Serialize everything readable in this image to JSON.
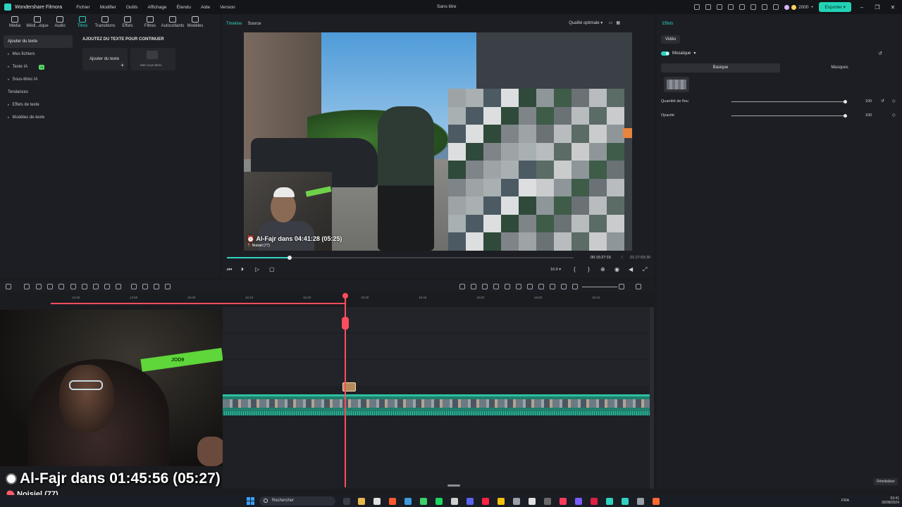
{
  "titlebar": {
    "app_name": "Wondershare Filmora",
    "menu": [
      "Fichier",
      "Modifier",
      "Outils",
      "Affichage",
      "Étendu",
      "Aide",
      "Version"
    ],
    "document_title": "Sans titre",
    "credits": "2000",
    "export_label": "Exporter"
  },
  "toolbar": {
    "items": [
      {
        "label": "Média",
        "icon": "media-icon"
      },
      {
        "label": "Médi...èque",
        "icon": "library-icon"
      },
      {
        "label": "Audio",
        "icon": "audio-icon"
      },
      {
        "label": "Titres",
        "icon": "titles-icon",
        "active": true
      },
      {
        "label": "Transitions",
        "icon": "transitions-icon"
      },
      {
        "label": "Effets",
        "icon": "effects-icon"
      },
      {
        "label": "Filtres",
        "icon": "filters-icon"
      },
      {
        "label": "Autocollants",
        "icon": "stickers-icon"
      },
      {
        "label": "Modèles",
        "icon": "templates-icon"
      }
    ]
  },
  "sidebar": {
    "items": [
      {
        "label": "Ajouter du texte"
      },
      {
        "label": "Mes fichiers"
      },
      {
        "label": "Texte IA",
        "badge": "AI"
      },
      {
        "label": "Sous-titres IA"
      },
      {
        "label": "Tendances"
      },
      {
        "label": "Effets de texte"
      },
      {
        "label": "Modèles de texte"
      }
    ]
  },
  "content": {
    "heading": "AJOUTEZ DU TEXTE POUR CONTINUER",
    "card_add_text": "Ajouter du texte",
    "card_subtitles": "Mes sous-titres"
  },
  "viewer": {
    "tab_timeline": "Timeline",
    "tab_source": "Source",
    "quality": "Qualité optimale",
    "overlay_title": "Al-Fajr dans 04:41:28 (05:25)",
    "overlay_sub": "Noisiel (77)",
    "progress": 0.18,
    "time_current": "00:15:27:15",
    "time_separator": "/",
    "time_total": "01:27:59:30",
    "aspect_ratio": "16:9"
  },
  "effects": {
    "title": "Effets",
    "tab_video": "Vidéo",
    "effect_name": "Mosaïque",
    "seg_basic": "Basique",
    "seg_masks": "Masques",
    "blur_label": "Quantité de flou",
    "blur_value": "100",
    "opacity_label": "Opacité",
    "opacity_value": "100",
    "reset_label": "Réinitialiser"
  },
  "timeline": {
    "ticks": [
      "14:40",
      "14:50",
      "15:00",
      "15:10",
      "15:20",
      "15:30",
      "15:40",
      "15:50",
      "16:00",
      "16:10"
    ]
  },
  "stream": {
    "title": "Al-Fajr dans 01:45:56 (05:27)",
    "location": "Noisiel (77)",
    "mic_text": "JOD9"
  },
  "taskbar": {
    "search_placeholder": "Rechercher",
    "lang": "FRA",
    "time": "03:41",
    "date": "30/08/2024"
  },
  "colors": {
    "accent": "#2fd3c2",
    "playhead": "#ff4d5e",
    "clip": "#1f7f6c"
  }
}
